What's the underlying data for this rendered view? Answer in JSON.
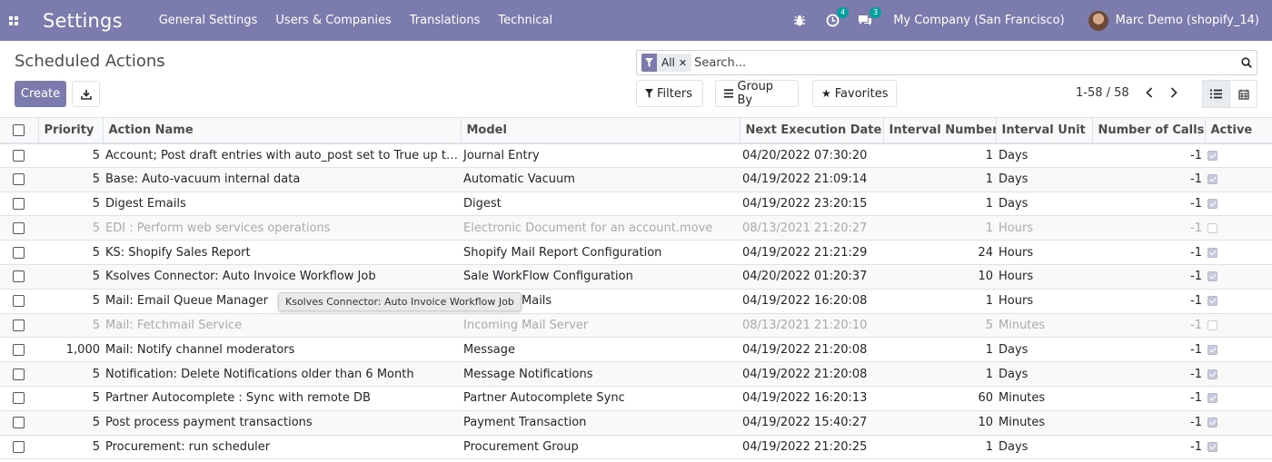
{
  "app": {
    "title": "Settings"
  },
  "menu": [
    "General Settings",
    "Users & Companies",
    "Translations",
    "Technical"
  ],
  "systray": {
    "activity_count": "4",
    "messages_count": "3",
    "company": "My Company (San Francisco)",
    "user": "Marc Demo (shopify_14)"
  },
  "page": {
    "title": "Scheduled Actions",
    "create_label": "Create"
  },
  "search": {
    "facet": "All",
    "placeholder": "Search..."
  },
  "filters": {
    "filters_label": "Filters",
    "groupby_label": "Group By",
    "favorites_label": "Favorites"
  },
  "pager": {
    "text": "1-58 / 58"
  },
  "colors": {
    "navbar": "#7c7bad",
    "accent": "#7c7bad",
    "teal_badge": "#00a09d"
  },
  "table": {
    "headers": [
      "Priority",
      "Action Name",
      "Model",
      "Next Execution Date",
      "Interval Number",
      "Interval Unit",
      "Number of Calls",
      "Active"
    ],
    "rows": [
      {
        "priority": "5",
        "name": "Account; Post draft entries with auto_post set to True up to today",
        "model": "Journal Entry",
        "next": "04/20/2022 07:30:20",
        "interval": "1",
        "unit": "Days",
        "calls": "-1",
        "active": true
      },
      {
        "priority": "5",
        "name": "Base: Auto-vacuum internal data",
        "model": "Automatic Vacuum",
        "next": "04/19/2022 21:09:14",
        "interval": "1",
        "unit": "Days",
        "calls": "-1",
        "active": true
      },
      {
        "priority": "5",
        "name": "Digest Emails",
        "model": "Digest",
        "next": "04/19/2022 23:20:15",
        "interval": "1",
        "unit": "Days",
        "calls": "-1",
        "active": true
      },
      {
        "priority": "5",
        "name": "EDI : Perform web services operations",
        "model": "Electronic Document for an account.move",
        "next": "08/13/2021 21:20:27",
        "interval": "1",
        "unit": "Hours",
        "calls": "-1",
        "active": false
      },
      {
        "priority": "5",
        "name": "KS: Shopify Sales Report",
        "model": "Shopify Mail Report Configuration",
        "next": "04/19/2022 21:21:29",
        "interval": "24",
        "unit": "Hours",
        "calls": "-1",
        "active": true
      },
      {
        "priority": "5",
        "name": "Ksolves Connector: Auto Invoice Workflow Job",
        "model": "Sale WorkFlow Configuration",
        "next": "04/20/2022 01:20:37",
        "interval": "10",
        "unit": "Hours",
        "calls": "-1",
        "active": true
      },
      {
        "priority": "5",
        "name": "Mail: Email Queue Manager",
        "model": "Outgoing Mails",
        "next": "04/19/2022 16:20:08",
        "interval": "1",
        "unit": "Hours",
        "calls": "-1",
        "active": true
      },
      {
        "priority": "5",
        "name": "Mail: Fetchmail Service",
        "model": "Incoming Mail Server",
        "next": "08/13/2021 21:20:10",
        "interval": "5",
        "unit": "Minutes",
        "calls": "-1",
        "active": false
      },
      {
        "priority": "1,000",
        "name": "Mail: Notify channel moderators",
        "model": "Message",
        "next": "04/19/2022 21:20:08",
        "interval": "1",
        "unit": "Days",
        "calls": "-1",
        "active": true
      },
      {
        "priority": "5",
        "name": "Notification: Delete Notifications older than 6 Month",
        "model": "Message Notifications",
        "next": "04/19/2022 21:20:08",
        "interval": "1",
        "unit": "Days",
        "calls": "-1",
        "active": true
      },
      {
        "priority": "5",
        "name": "Partner Autocomplete : Sync with remote DB",
        "model": "Partner Autocomplete Sync",
        "next": "04/19/2022 16:20:13",
        "interval": "60",
        "unit": "Minutes",
        "calls": "-1",
        "active": true
      },
      {
        "priority": "5",
        "name": "Post process payment transactions",
        "model": "Payment Transaction",
        "next": "04/19/2022 15:40:27",
        "interval": "10",
        "unit": "Minutes",
        "calls": "-1",
        "active": true
      },
      {
        "priority": "5",
        "name": "Procurement: run scheduler",
        "model": "Procurement Group",
        "next": "04/19/2022 21:20:25",
        "interval": "1",
        "unit": "Days",
        "calls": "-1",
        "active": true
      }
    ]
  },
  "tooltip": {
    "text": "Ksolves Connector: Auto Invoice Workflow Job"
  }
}
